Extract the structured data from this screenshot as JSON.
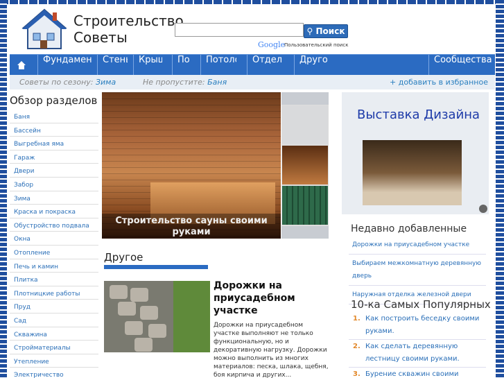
{
  "header": {
    "title_line1": "Строительство",
    "title_line2": "Советы",
    "search_button": "Поиск",
    "google_label": "Google",
    "search_note": "Пользовательский поиск"
  },
  "nav": {
    "items": [
      "Фундамент",
      "Стены",
      "Крыша",
      "Пол",
      "Потолок",
      "Отделка",
      "Другое",
      "Сообщества"
    ]
  },
  "subbar": {
    "season_label": "Советы по сезону:",
    "season_value": "Зима",
    "miss_label": "Не пропустите:",
    "miss_value": "Баня",
    "favorite": "+ добавить в избранное"
  },
  "sidebar": {
    "title": "Обзор разделов",
    "items": [
      "Баня",
      "Бассейн",
      "Выгребная яма",
      "Гараж",
      "Двери",
      "Забор",
      "Зима",
      "Краска и покраска",
      "Обустройство подвала",
      "Окна",
      "Отопление",
      "Печь и камин",
      "Плитка",
      "Плотницкие работы",
      "Пруд",
      "Сад",
      "Скважина",
      "Стройматериалы",
      "Утепление",
      "Электричество"
    ]
  },
  "slider": {
    "caption": "Строительство сауны своими руками"
  },
  "section": {
    "title": "Другое",
    "article_title": "Дорожки на приусадебном участке",
    "article_text": "Дорожки на приусадебном участке выполняют не только функциональную, но и декоративную нагрузку. Дорожки можно выполнить из многих материалов: песка, шлака, щебня, боя кирпича и других..."
  },
  "ad": {
    "title": "Выставка Дизайна"
  },
  "recent": {
    "title": "Недавно добавленные",
    "items": [
      "Дорожки на приусадебном участке",
      "Выбираем межкомнатную деревянную дверь",
      "Наружная отделка железной двери"
    ]
  },
  "popular": {
    "title": "10-ка Самых Популярных",
    "items": [
      {
        "num": "1.",
        "text": "Как построить беседку своими руками."
      },
      {
        "num": "2.",
        "text": "Как сделать деревянную лестницу своими руками."
      },
      {
        "num": "3.",
        "text": "Бурение скважин своими"
      }
    ]
  },
  "colors": {
    "nav": "#2b6bc2",
    "link": "#2a6fb8",
    "accent": "#e2882a"
  }
}
